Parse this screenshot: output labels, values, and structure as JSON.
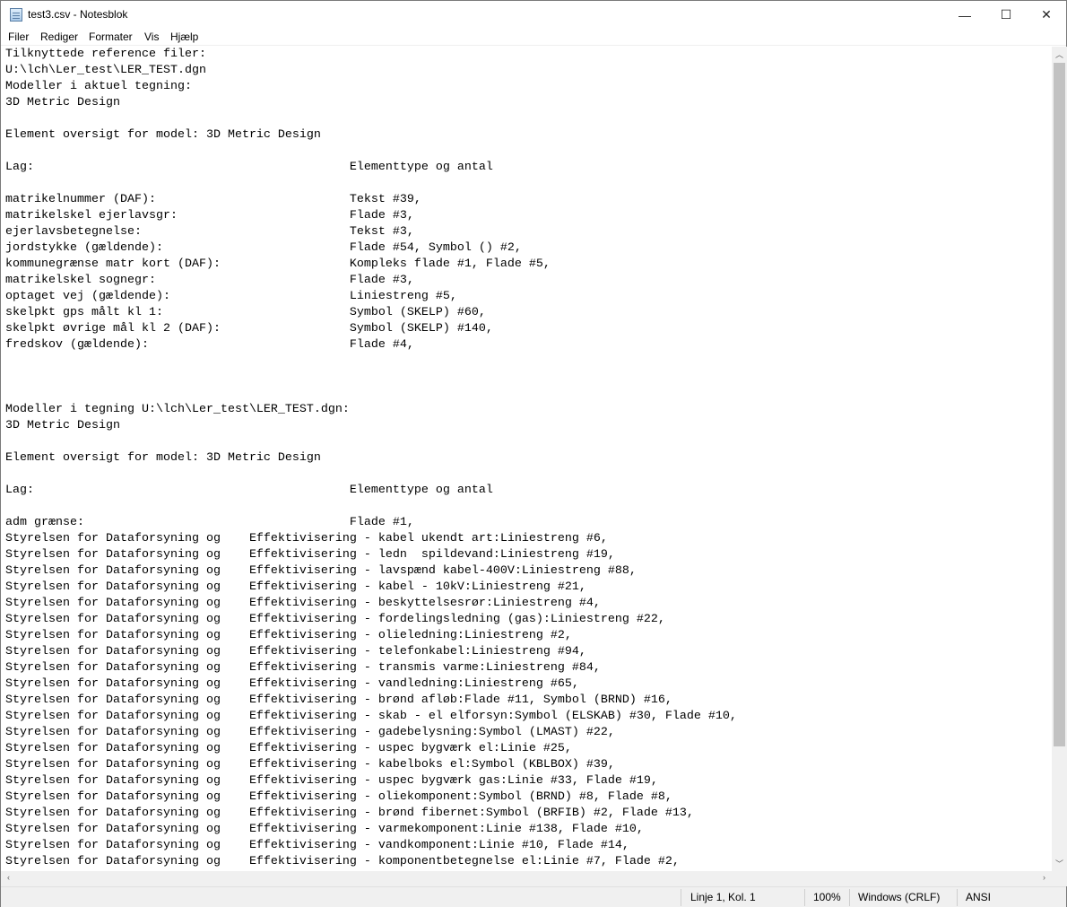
{
  "window": {
    "title": "test3.csv - Notesblok",
    "minimize": "—",
    "maximize": "☐",
    "close": "✕"
  },
  "menu": [
    "Filer",
    "Rediger",
    "Formater",
    "Vis",
    "Hjælp"
  ],
  "lines": [
    "Tilknyttede reference filer:",
    "U:\\lch\\Ler_test\\LER_TEST.dgn",
    "Modeller i aktuel tegning:",
    "3D Metric Design",
    "",
    "Element oversigt for model: 3D Metric Design",
    "",
    "Lag:                                            Elementtype og antal",
    "",
    "matrikelnummer (DAF):                           Tekst #39,",
    "matrikelskel ejerlavsgr:                        Flade #3,",
    "ejerlavsbetegnelse:                             Tekst #3,",
    "jordstykke (gældende):                          Flade #54, Symbol () #2,",
    "kommunegrænse matr kort (DAF):                  Kompleks flade #1, Flade #5,",
    "matrikelskel sognegr:                           Flade #3,",
    "optaget vej (gældende):                         Liniestreng #5,",
    "skelpkt gps målt kl 1:                          Symbol (SKELP) #60,",
    "skelpkt øvrige mål kl 2 (DAF):                  Symbol (SKELP) #140,",
    "fredskov (gældende):                            Flade #4,",
    "",
    "",
    "",
    "Modeller i tegning U:\\lch\\Ler_test\\LER_TEST.dgn:",
    "3D Metric Design",
    "",
    "Element oversigt for model: 3D Metric Design",
    "",
    "Lag:                                            Elementtype og antal",
    "",
    "adm grænse:                                     Flade #1,",
    "Styrelsen for Dataforsyning og    Effektivisering - kabel ukendt art:Liniestreng #6,",
    "Styrelsen for Dataforsyning og    Effektivisering - ledn  spildevand:Liniestreng #19,",
    "Styrelsen for Dataforsyning og    Effektivisering - lavspænd kabel-400V:Liniestreng #88,",
    "Styrelsen for Dataforsyning og    Effektivisering - kabel - 10kV:Liniestreng #21,",
    "Styrelsen for Dataforsyning og    Effektivisering - beskyttelsesrør:Liniestreng #4,",
    "Styrelsen for Dataforsyning og    Effektivisering - fordelingsledning (gas):Liniestreng #22,",
    "Styrelsen for Dataforsyning og    Effektivisering - olieledning:Liniestreng #2,",
    "Styrelsen for Dataforsyning og    Effektivisering - telefonkabel:Liniestreng #94,",
    "Styrelsen for Dataforsyning og    Effektivisering - transmis varme:Liniestreng #84,",
    "Styrelsen for Dataforsyning og    Effektivisering - vandledning:Liniestreng #65,",
    "Styrelsen for Dataforsyning og    Effektivisering - brønd afløb:Flade #11, Symbol (BRND) #16,",
    "Styrelsen for Dataforsyning og    Effektivisering - skab - el elforsyn:Symbol (ELSKAB) #30, Flade #10,",
    "Styrelsen for Dataforsyning og    Effektivisering - gadebelysning:Symbol (LMAST) #22,",
    "Styrelsen for Dataforsyning og    Effektivisering - uspec bygværk el:Linie #25,",
    "Styrelsen for Dataforsyning og    Effektivisering - kabelboks el:Symbol (KBLBOX) #39,",
    "Styrelsen for Dataforsyning og    Effektivisering - uspec bygværk gas:Linie #33, Flade #19,",
    "Styrelsen for Dataforsyning og    Effektivisering - oliekomponent:Symbol (BRND) #8, Flade #8,",
    "Styrelsen for Dataforsyning og    Effektivisering - brønd fibernet:Symbol (BRFIB) #2, Flade #13,",
    "Styrelsen for Dataforsyning og    Effektivisering - varmekomponent:Linie #138, Flade #10,",
    "Styrelsen for Dataforsyning og    Effektivisering - vandkomponent:Linie #10, Flade #14,",
    "Styrelsen for Dataforsyning og    Effektivisering - komponentbetegnelse el:Linie #7, Flade #2,"
  ],
  "status": {
    "position": "Linje 1, Kol. 1",
    "zoom": "100%",
    "line_ending": "Windows (CRLF)",
    "encoding": "ANSI"
  }
}
